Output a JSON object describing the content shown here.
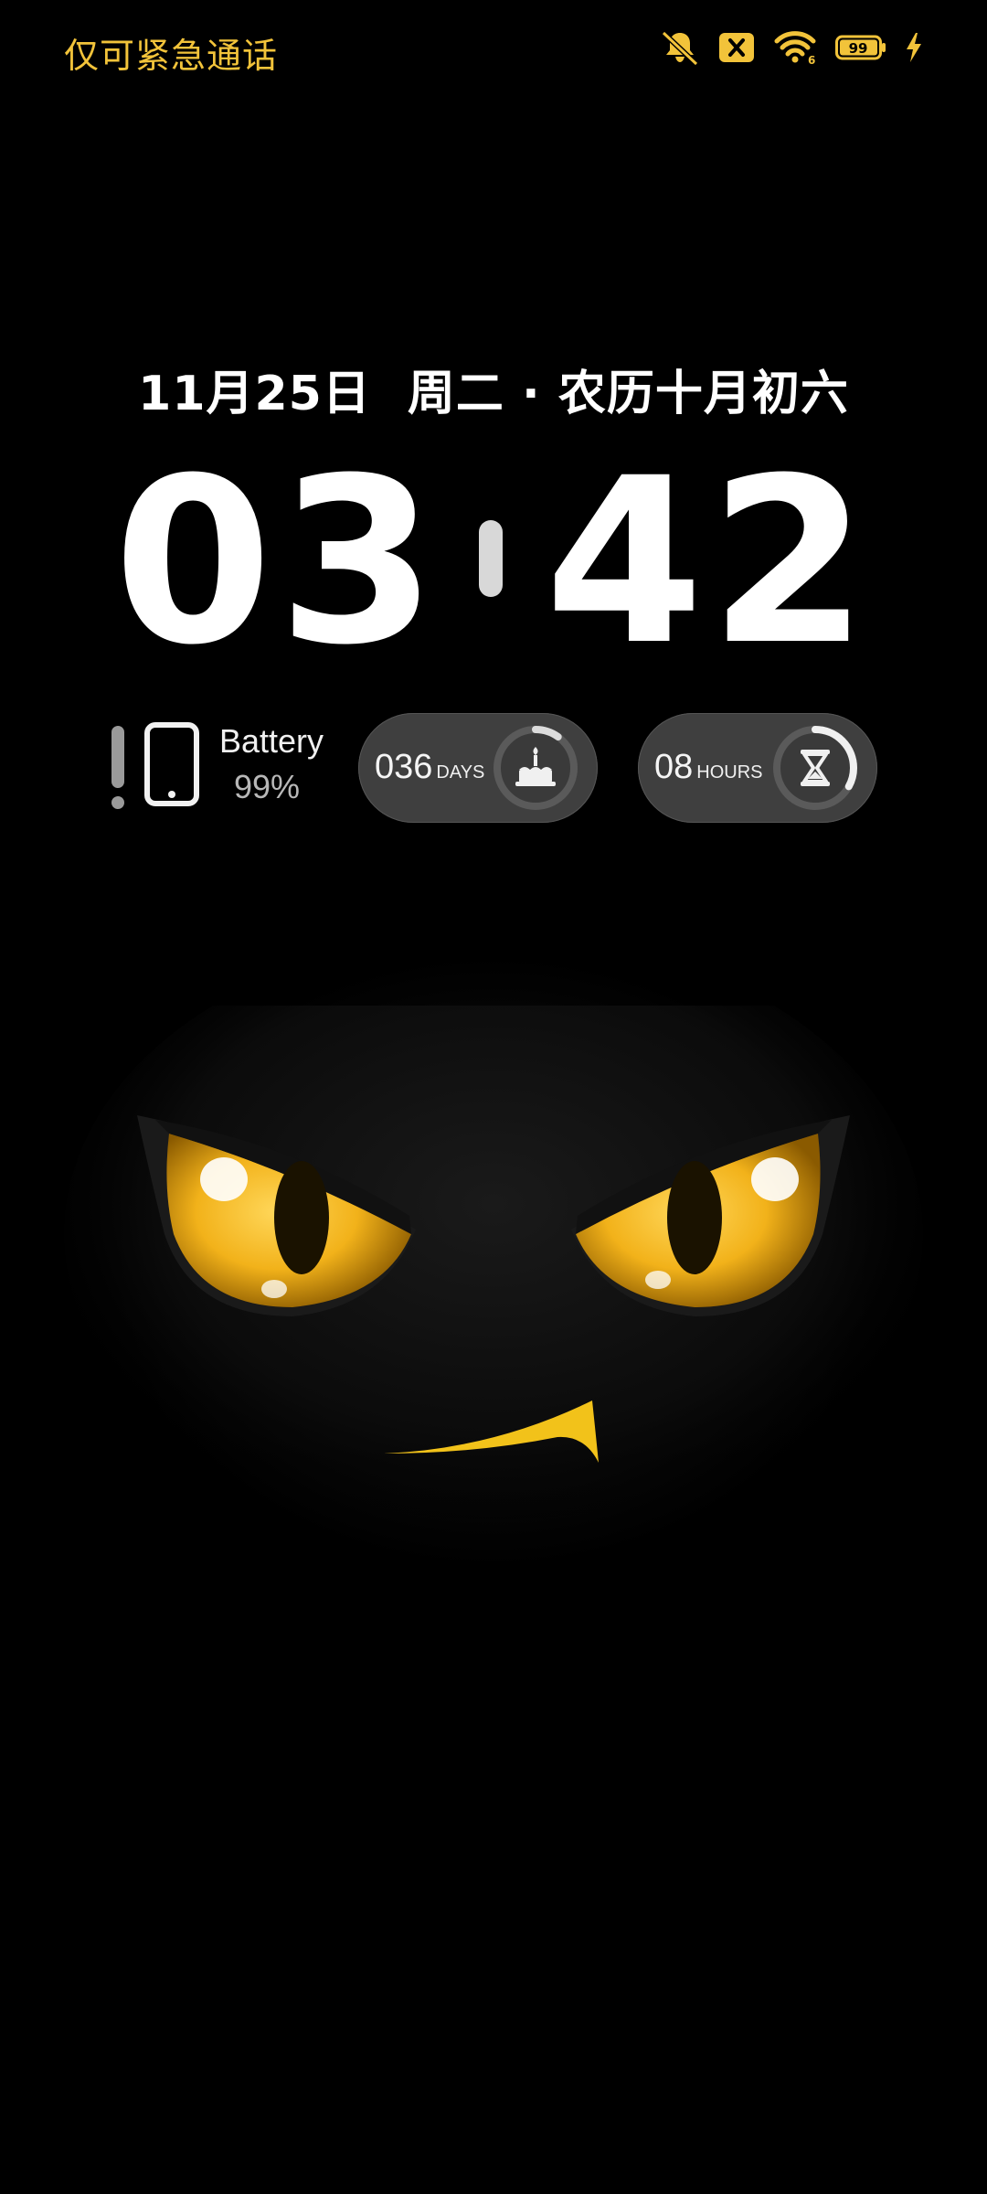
{
  "status_bar": {
    "carrier_text": "仅可紧急通话",
    "icons": [
      "bell-muted-icon",
      "sim-x-icon",
      "wifi-icon",
      "battery-icon",
      "charging-bolt-icon"
    ],
    "battery_level_label": "99",
    "accent_color": "#f2c33a"
  },
  "lockscreen": {
    "date": "11月25日",
    "weekday_lunar": "周二 · 农历十月初六",
    "time_hours": "03",
    "time_minutes": "42"
  },
  "widgets": {
    "battery": {
      "label": "Battery",
      "value": "99%",
      "level": 0.99,
      "icons": [
        "alert-bar-icon",
        "phone-icon"
      ]
    },
    "days_counter": {
      "value": "036",
      "unit": "DAYS",
      "icon": "cake-icon",
      "progress": 0.1
    },
    "hours_counter": {
      "value": "08",
      "unit": "HOURS",
      "icon": "hourglass-icon",
      "progress": 0.33
    }
  },
  "wallpaper": {
    "subject": "black-cat-face",
    "eye_color": "#f2b21a"
  }
}
